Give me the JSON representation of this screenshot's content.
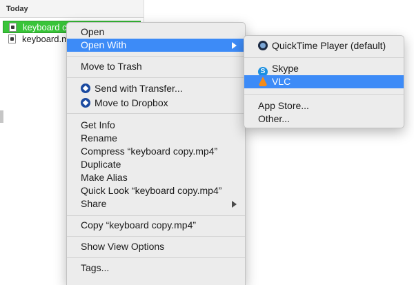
{
  "finder": {
    "header": "Today",
    "files": [
      {
        "name": "keyboard copy.mp4",
        "selected": true
      },
      {
        "name": "keyboard.mp4",
        "selected": false
      }
    ]
  },
  "context_menu": {
    "open": "Open",
    "open_with": "Open With",
    "move_to_trash": "Move to Trash",
    "send_with_transfer": "Send with Transfer...",
    "move_to_dropbox": "Move to Dropbox",
    "get_info": "Get Info",
    "rename": "Rename",
    "compress": "Compress “keyboard copy.mp4”",
    "duplicate": "Duplicate",
    "make_alias": "Make Alias",
    "quick_look": "Quick Look “keyboard copy.mp4”",
    "share": "Share",
    "copy": "Copy “keyboard copy.mp4”",
    "show_view_options": "Show View Options",
    "tags": "Tags..."
  },
  "open_with_submenu": {
    "quicktime": "QuickTime Player (default)",
    "skype": "Skype",
    "vlc": "VLC",
    "app_store": "App Store...",
    "other": "Other..."
  },
  "colors": {
    "highlight": "#3d8bf7",
    "selected_file": "#39c439"
  }
}
